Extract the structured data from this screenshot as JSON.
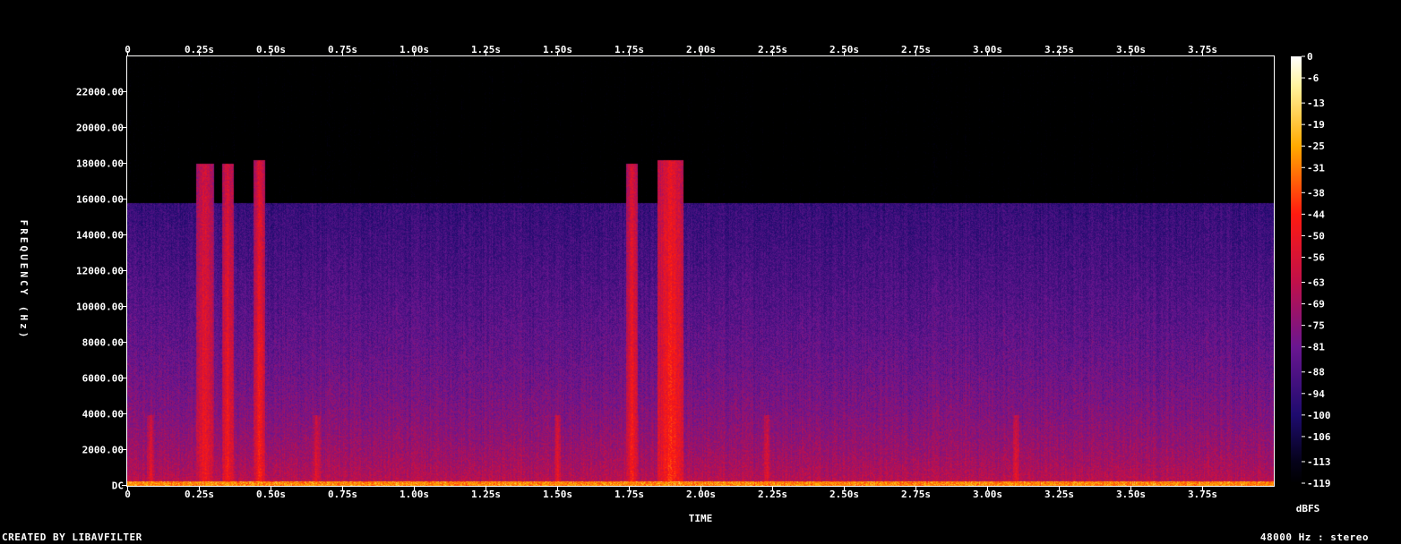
{
  "footer": {
    "left": "CREATED BY LIBAVFILTER",
    "right": "48000 Hz : stereo"
  },
  "chart_data": {
    "type": "heatmap",
    "title": "",
    "xlabel": "TIME",
    "ylabel": "FREQUENCY (Hz)",
    "colorbar_label": "dBFS",
    "x_unit": "s",
    "xlim": [
      0,
      4.0
    ],
    "ylim": [
      0,
      24000
    ],
    "clim": [
      -119,
      0
    ],
    "x_ticks": [
      {
        "value": 0,
        "label": "0"
      },
      {
        "value": 0.25,
        "label": "0.25s"
      },
      {
        "value": 0.5,
        "label": "0.50s"
      },
      {
        "value": 0.75,
        "label": "0.75s"
      },
      {
        "value": 1.0,
        "label": "1.00s"
      },
      {
        "value": 1.25,
        "label": "1.25s"
      },
      {
        "value": 1.5,
        "label": "1.50s"
      },
      {
        "value": 1.75,
        "label": "1.75s"
      },
      {
        "value": 2.0,
        "label": "2.00s"
      },
      {
        "value": 2.25,
        "label": "2.25s"
      },
      {
        "value": 2.5,
        "label": "2.50s"
      },
      {
        "value": 2.75,
        "label": "2.75s"
      },
      {
        "value": 3.0,
        "label": "3.00s"
      },
      {
        "value": 3.25,
        "label": "3.25s"
      },
      {
        "value": 3.5,
        "label": "3.50s"
      },
      {
        "value": 3.75,
        "label": "3.75s"
      }
    ],
    "y_ticks": [
      {
        "value": 0,
        "label": "DC"
      },
      {
        "value": 2000,
        "label": "2000.00"
      },
      {
        "value": 4000,
        "label": "4000.00"
      },
      {
        "value": 6000,
        "label": "6000.00"
      },
      {
        "value": 8000,
        "label": "8000.00"
      },
      {
        "value": 10000,
        "label": "10000.00"
      },
      {
        "value": 12000,
        "label": "12000.00"
      },
      {
        "value": 14000,
        "label": "14000.00"
      },
      {
        "value": 16000,
        "label": "16000.00"
      },
      {
        "value": 18000,
        "label": "18000.00"
      },
      {
        "value": 20000,
        "label": "20000.00"
      },
      {
        "value": 22000,
        "label": "22000.00"
      }
    ],
    "colorbar_ticks": [
      0,
      -6,
      -13,
      -19,
      -25,
      -31,
      -38,
      -44,
      -50,
      -56,
      -63,
      -69,
      -75,
      -81,
      -88,
      -94,
      -100,
      -106,
      -113,
      -119
    ],
    "colormap": [
      {
        "db": 0,
        "color": "#ffffff"
      },
      {
        "db": -8,
        "color": "#fff4a0"
      },
      {
        "db": -25,
        "color": "#ffaa00"
      },
      {
        "db": -44,
        "color": "#ff1a10"
      },
      {
        "db": -63,
        "color": "#c0104a"
      },
      {
        "db": -81,
        "color": "#6a1690"
      },
      {
        "db": -100,
        "color": "#1e0b6e"
      },
      {
        "db": -113,
        "color": "#05021a"
      },
      {
        "db": -119,
        "color": "#000000"
      }
    ],
    "content_cutoff_hz": 15800,
    "bursts": [
      {
        "t_start": 0.24,
        "t_end": 0.3,
        "max_hz": 18000,
        "level_db": -48
      },
      {
        "t_start": 0.33,
        "t_end": 0.37,
        "max_hz": 18000,
        "level_db": -46
      },
      {
        "t_start": 0.44,
        "t_end": 0.48,
        "max_hz": 18200,
        "level_db": -45
      },
      {
        "t_start": 1.74,
        "t_end": 1.78,
        "max_hz": 18000,
        "level_db": -45
      },
      {
        "t_start": 1.85,
        "t_end": 1.94,
        "max_hz": 18200,
        "level_db": -42
      }
    ],
    "transients_s": [
      0.08,
      0.27,
      0.66,
      1.5,
      1.77,
      2.23,
      3.1
    ]
  }
}
